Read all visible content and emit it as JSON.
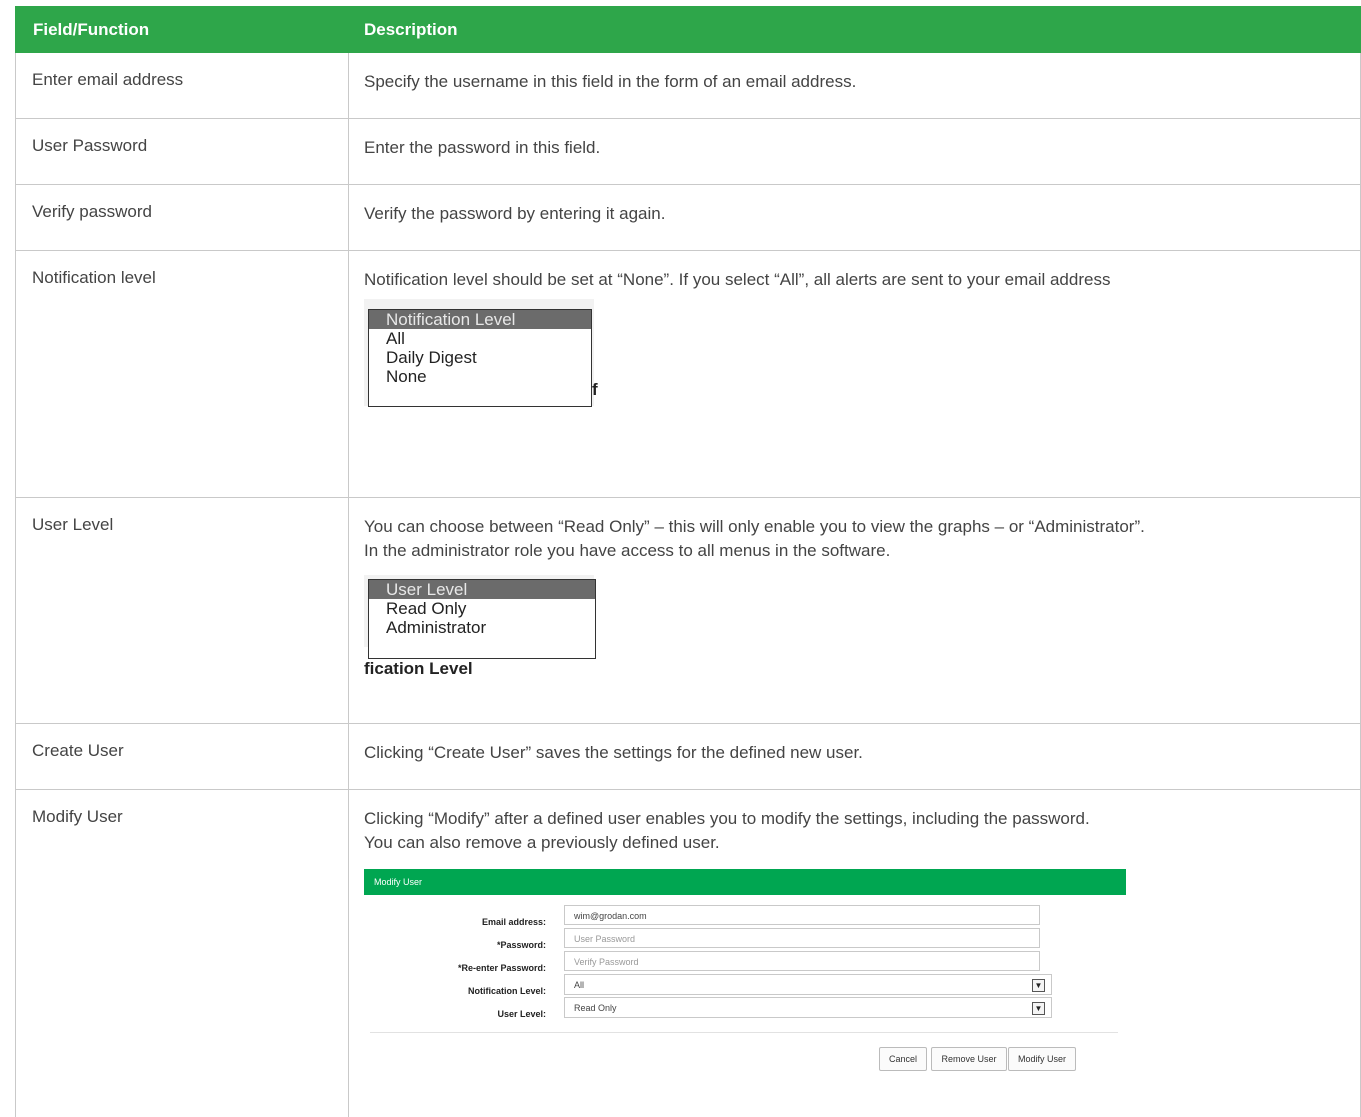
{
  "headers": {
    "field": "Field/Function",
    "description": "Description"
  },
  "rows": [
    {
      "field": "Enter email address",
      "desc": [
        "Specify the username in this field in the form of an email address."
      ]
    },
    {
      "field": "User Password",
      "desc": [
        "Enter the password in this field."
      ]
    },
    {
      "field": "Verify password",
      "desc": [
        "Verify the password by entering it again."
      ]
    },
    {
      "field": "Notification level",
      "desc": [
        "Notification level should be set at “None”. If you select “All”, all alerts are sent to your email address"
      ]
    },
    {
      "field": "User Level",
      "desc": [
        "You can choose between “Read Only” – this will only enable you to view the graphs – or “Administrator”.",
        "In the administrator role you have access to all menus in the software."
      ]
    },
    {
      "field": "Create User",
      "desc": [
        "Clicking “Create User” saves the settings for the defined new user."
      ]
    },
    {
      "field": "Modify User",
      "desc": [
        "Clicking “Modify” after a defined user enables you to modify the settings, including the password.",
        "You can also remove a previously defined user."
      ]
    }
  ],
  "notification_dropdown": {
    "options": [
      "Notification Level",
      "All",
      "Daily Digest",
      "None"
    ],
    "selected": "Notification Level",
    "peek_text": "f"
  },
  "user_level_dropdown": {
    "options": [
      "User Level",
      "Read Only",
      "Administrator"
    ],
    "selected": "User Level",
    "peek_text": "fication Level"
  },
  "modify_user_form": {
    "title": "Modify User",
    "email_label": "Email address:",
    "email_value": "wim@grodan.com",
    "password_label": "*Password:",
    "password_placeholder": "User Password",
    "reenter_label": "*Re-enter Password:",
    "reenter_placeholder": "Verify Password",
    "notification_label": "Notification Level:",
    "notification_value": "All",
    "user_level_label": "User Level:",
    "user_level_value": "Read Only",
    "cancel_label": "Cancel",
    "remove_label": "Remove User",
    "modify_label": "Modify User"
  },
  "colors": {
    "header_green": "#2ea64a",
    "panel_green": "#00a651"
  }
}
